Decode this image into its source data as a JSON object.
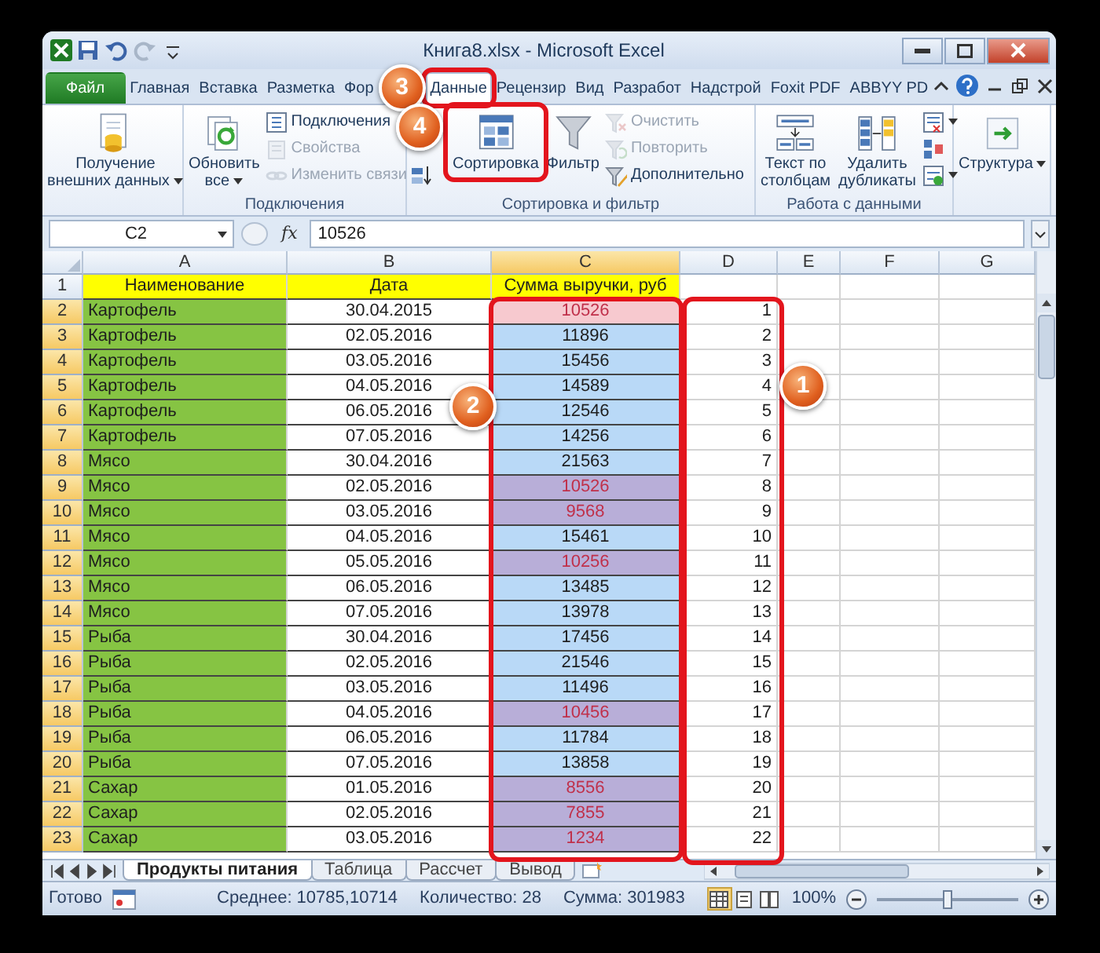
{
  "window": {
    "title": "Книга8.xlsx - Microsoft Excel"
  },
  "tabs": [
    {
      "label": "Файл",
      "kind": "file",
      "selected": false
    },
    {
      "label": "Главная",
      "kind": "tab",
      "selected": false
    },
    {
      "label": "Вставка",
      "kind": "tab",
      "selected": false
    },
    {
      "label": "Разметка",
      "kind": "tab",
      "selected": false
    },
    {
      "label": "Фор",
      "kind": "tab",
      "selected": false
    },
    {
      "label": "Данные",
      "kind": "tab",
      "selected": true
    },
    {
      "label": "Рецензир",
      "kind": "tab",
      "selected": false
    },
    {
      "label": "Вид",
      "kind": "tab",
      "selected": false
    },
    {
      "label": "Разработ",
      "kind": "tab",
      "selected": false
    },
    {
      "label": "Надстрой",
      "kind": "tab",
      "selected": false
    },
    {
      "label": "Foxit PDF",
      "kind": "tab",
      "selected": false
    },
    {
      "label": "ABBYY PD",
      "kind": "tab",
      "selected": false
    }
  ],
  "ribbon": {
    "groups": [
      {
        "items": [
          {
            "kind": "large",
            "label": "Получение\nвнешних данных",
            "menu": true,
            "disabled": false
          }
        ]
      },
      {
        "label": "Подключения",
        "items": [
          {
            "kind": "large",
            "label": "Обновить\nвсе",
            "menu": true,
            "disabled": false
          },
          {
            "kind": "small",
            "label": "Подключения",
            "disabled": false
          },
          {
            "kind": "small",
            "label": "Свойства",
            "disabled": true
          },
          {
            "kind": "small",
            "label": "Изменить связи",
            "disabled": true
          }
        ]
      },
      {
        "label": "Сортировка и фильтр",
        "items": [
          {
            "kind": "icon",
            "menu": false,
            "disabled": false
          },
          {
            "kind": "large",
            "label": "Сортировка",
            "menu": false,
            "disabled": false
          },
          {
            "kind": "large",
            "label": "Фильтр",
            "menu": false,
            "disabled": false
          },
          {
            "kind": "small",
            "label": "Очистить",
            "disabled": true
          },
          {
            "kind": "small",
            "label": "Повторить",
            "disabled": true
          },
          {
            "kind": "small",
            "label": "Дополнительно",
            "disabled": false
          }
        ]
      },
      {
        "label": "Работа с данными",
        "items": [
          {
            "kind": "large",
            "label": "Текст по\nстолбцам",
            "menu": false,
            "disabled": false
          },
          {
            "kind": "large",
            "label": "Удалить\nдубликаты",
            "menu": false,
            "disabled": false
          },
          {
            "kind": "icon",
            "menu": true,
            "disabled": false
          },
          {
            "kind": "icon",
            "menu": false,
            "disabled": false
          },
          {
            "kind": "icon",
            "menu": true,
            "disabled": false
          }
        ]
      },
      {
        "items": [
          {
            "kind": "large",
            "label": "Структура",
            "menu": true,
            "disabled": false
          }
        ]
      }
    ]
  },
  "formula_bar": {
    "name_box": "C2",
    "fx": "fx",
    "value": "10526"
  },
  "columns": [
    {
      "label": "A",
      "selected": false
    },
    {
      "label": "B",
      "selected": false
    },
    {
      "label": "C",
      "selected": true
    },
    {
      "label": "D",
      "selected": false
    },
    {
      "label": "E",
      "selected": false
    },
    {
      "label": "F",
      "selected": false
    },
    {
      "label": "G",
      "selected": false
    }
  ],
  "rows": [
    {
      "num": "1",
      "kind": "header",
      "name": "Наименование",
      "date": "Дата",
      "sum": "Сумма выручки, руб",
      "selected": false
    },
    {
      "num": "2",
      "kind": "data",
      "name": "Картофель",
      "date": "30.04.2015",
      "sum": "10526",
      "rank": "1",
      "selected": true,
      "flagged": true,
      "active": true
    },
    {
      "num": "3",
      "kind": "data",
      "name": "Картофель",
      "date": "02.05.2016",
      "sum": "11896",
      "rank": "2",
      "selected": true,
      "flagged": false,
      "active": false
    },
    {
      "num": "4",
      "kind": "data",
      "name": "Картофель",
      "date": "03.05.2016",
      "sum": "15456",
      "rank": "3",
      "selected": true,
      "flagged": false,
      "active": false
    },
    {
      "num": "5",
      "kind": "data",
      "name": "Картофель",
      "date": "04.05.2016",
      "sum": "14589",
      "rank": "4",
      "selected": true,
      "flagged": false,
      "active": false
    },
    {
      "num": "6",
      "kind": "data",
      "name": "Картофель",
      "date": "06.05.2016",
      "sum": "12546",
      "rank": "5",
      "selected": true,
      "flagged": false,
      "active": false
    },
    {
      "num": "7",
      "kind": "data",
      "name": "Картофель",
      "date": "07.05.2016",
      "sum": "14256",
      "rank": "6",
      "selected": true,
      "flagged": false,
      "active": false
    },
    {
      "num": "8",
      "kind": "data",
      "name": "Мясо",
      "date": "30.04.2016",
      "sum": "21563",
      "rank": "7",
      "selected": true,
      "flagged": false,
      "active": false
    },
    {
      "num": "9",
      "kind": "data",
      "name": "Мясо",
      "date": "02.05.2016",
      "sum": "10526",
      "rank": "8",
      "selected": true,
      "flagged": true,
      "active": false
    },
    {
      "num": "10",
      "kind": "data",
      "name": "Мясо",
      "date": "03.05.2016",
      "sum": "9568",
      "rank": "9",
      "selected": true,
      "flagged": true,
      "active": false
    },
    {
      "num": "11",
      "kind": "data",
      "name": "Мясо",
      "date": "04.05.2016",
      "sum": "15461",
      "rank": "10",
      "selected": true,
      "flagged": false,
      "active": false
    },
    {
      "num": "12",
      "kind": "data",
      "name": "Мясо",
      "date": "05.05.2016",
      "sum": "10256",
      "rank": "11",
      "selected": true,
      "flagged": true,
      "active": false
    },
    {
      "num": "13",
      "kind": "data",
      "name": "Мясо",
      "date": "06.05.2016",
      "sum": "13485",
      "rank": "12",
      "selected": true,
      "flagged": false,
      "active": false
    },
    {
      "num": "14",
      "kind": "data",
      "name": "Мясо",
      "date": "07.05.2016",
      "sum": "13978",
      "rank": "13",
      "selected": true,
      "flagged": false,
      "active": false
    },
    {
      "num": "15",
      "kind": "data",
      "name": "Рыба",
      "date": "30.04.2016",
      "sum": "17456",
      "rank": "14",
      "selected": true,
      "flagged": false,
      "active": false
    },
    {
      "num": "16",
      "kind": "data",
      "name": "Рыба",
      "date": "02.05.2016",
      "sum": "21546",
      "rank": "15",
      "selected": true,
      "flagged": false,
      "active": false
    },
    {
      "num": "17",
      "kind": "data",
      "name": "Рыба",
      "date": "03.05.2016",
      "sum": "11496",
      "rank": "16",
      "selected": true,
      "flagged": false,
      "active": false
    },
    {
      "num": "18",
      "kind": "data",
      "name": "Рыба",
      "date": "04.05.2016",
      "sum": "10456",
      "rank": "17",
      "selected": true,
      "flagged": true,
      "active": false
    },
    {
      "num": "19",
      "kind": "data",
      "name": "Рыба",
      "date": "06.05.2016",
      "sum": "11784",
      "rank": "18",
      "selected": true,
      "flagged": false,
      "active": false
    },
    {
      "num": "20",
      "kind": "data",
      "name": "Рыба",
      "date": "07.05.2016",
      "sum": "13858",
      "rank": "19",
      "selected": true,
      "flagged": false,
      "active": false
    },
    {
      "num": "21",
      "kind": "data",
      "name": "Сахар",
      "date": "01.05.2016",
      "sum": "8556",
      "rank": "20",
      "selected": true,
      "flagged": true,
      "active": false
    },
    {
      "num": "22",
      "kind": "data",
      "name": "Сахар",
      "date": "02.05.2016",
      "sum": "7855",
      "rank": "21",
      "selected": true,
      "flagged": true,
      "active": false
    },
    {
      "num": "23",
      "kind": "data",
      "name": "Сахар",
      "date": "03.05.2016",
      "sum": "1234",
      "rank": "22",
      "selected": true,
      "flagged": true,
      "active": false
    }
  ],
  "sheet_tabs": [
    {
      "label": "Продукты питания",
      "selected": true
    },
    {
      "label": "Таблица",
      "selected": false
    },
    {
      "label": "Рассчет",
      "selected": false
    },
    {
      "label": "Вывод",
      "selected": false
    }
  ],
  "status_bar": {
    "ready": "Готово",
    "average": "Среднее: 10785,10714",
    "count": "Количество: 28",
    "sum": "Сумма: 301983",
    "views": [
      {
        "selected": true
      },
      {
        "selected": false
      },
      {
        "selected": false
      }
    ],
    "zoom": "100%",
    "zoom_slider": {
      "level": 0.5
    }
  },
  "annotations": [
    {
      "number": "3",
      "kind": "selected-tab"
    },
    {
      "number": "4",
      "kind": "sort-button"
    },
    {
      "number": "2",
      "kind": "sum-column"
    },
    {
      "number": "1",
      "kind": "rank-column"
    }
  ]
}
